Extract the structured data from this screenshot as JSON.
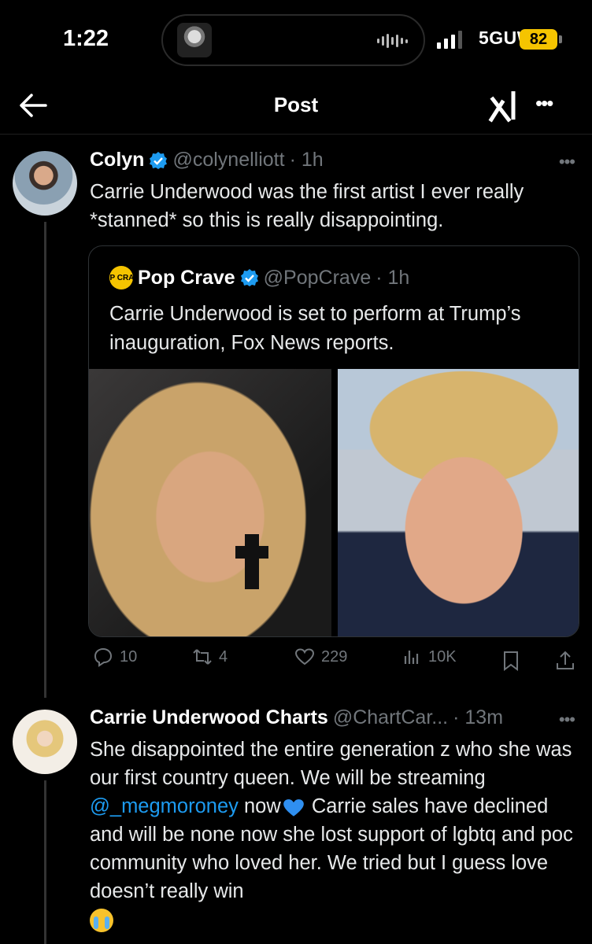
{
  "status_bar": {
    "time": "1:22",
    "network": "5GUW",
    "battery": "82"
  },
  "header": {
    "title": "Post"
  },
  "post": {
    "author": "Colyn",
    "handle": "@colynelliott",
    "time": "· 1h",
    "text": "Carrie Underwood was the first artist I ever really *stanned* so this is really disappointing.",
    "quote": {
      "logo_text": "POP CRAVE",
      "author": "Pop Crave",
      "handle": "@PopCrave",
      "time": "· 1h",
      "text": "Carrie Underwood is set to perform at Trump’s inauguration, Fox News reports."
    },
    "stats": {
      "replies": "10",
      "reposts": "4",
      "likes": "229",
      "views": "10K"
    }
  },
  "reply": {
    "author": "Carrie Underwood Charts",
    "handle": "@ChartCar...",
    "time": "· 13m",
    "text_1": "She disappointed the entire generation z who she was our first country queen. We will be streaming ",
    "mention": "@_megmoroney",
    "text_2": " now",
    "text_3": " Carrie sales have declined and will be none now she lost support of lgbtq and poc community who loved her. We tried but I guess love doesn’t really win"
  },
  "colors": {
    "accent": "#1d9bf0",
    "battery": "#f5c400",
    "muted": "#71767b"
  }
}
